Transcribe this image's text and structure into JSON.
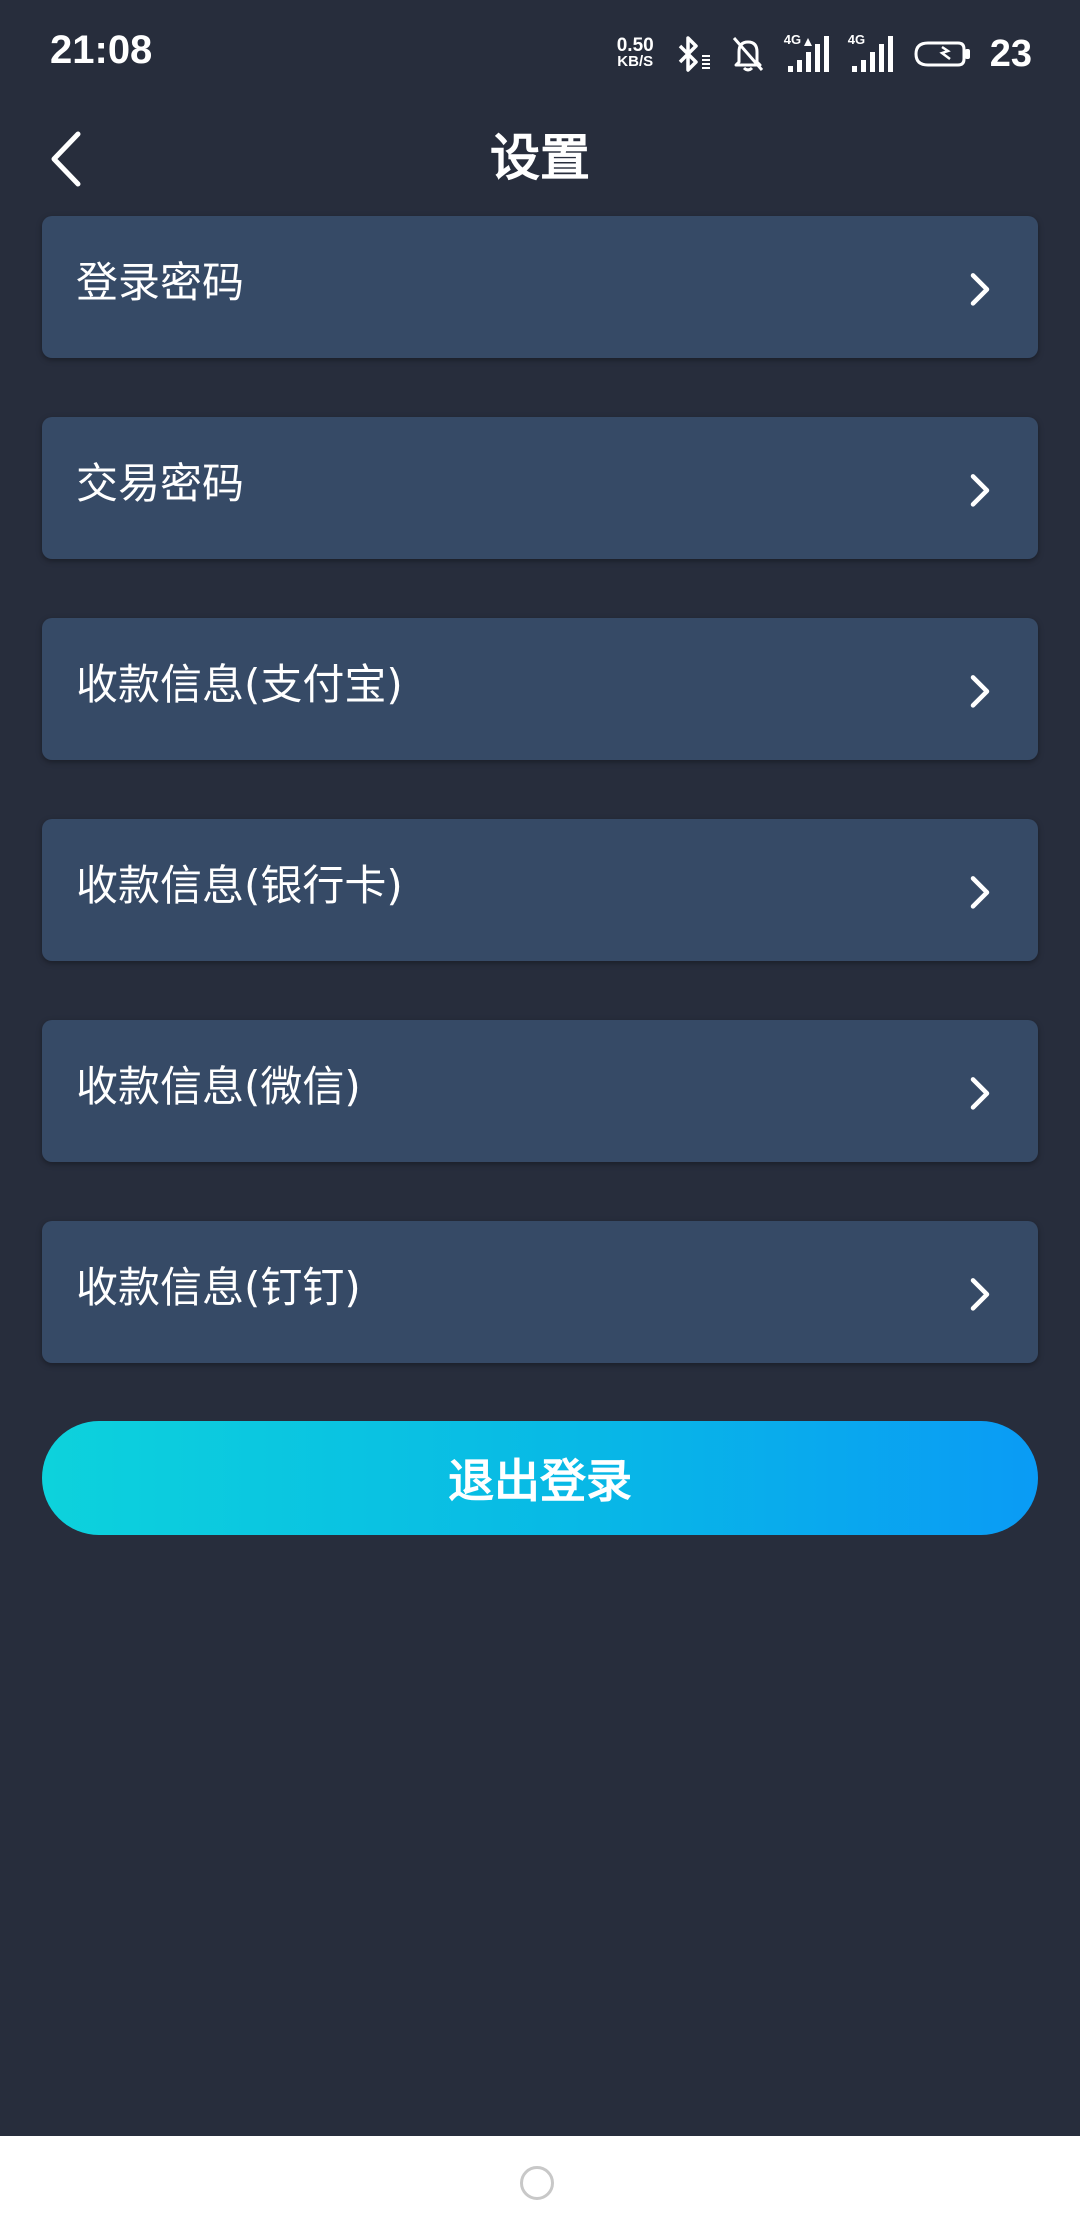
{
  "status_bar": {
    "time": "21:08",
    "net_speed_value": "0.50",
    "net_speed_unit": "KB/S",
    "sim1_label": "4G",
    "sim2_label": "4G",
    "battery_level": "23",
    "icons": [
      "bluetooth-icon",
      "mute-bell-icon",
      "signal-icon",
      "signal-icon",
      "battery-icon"
    ]
  },
  "header": {
    "title": "设置",
    "back_icon": "chevron-left-icon"
  },
  "settings": {
    "items": [
      {
        "label": "登录密码"
      },
      {
        "label": "交易密码"
      },
      {
        "label": "收款信息(支付宝)"
      },
      {
        "label": "收款信息(银行卡)"
      },
      {
        "label": "收款信息(微信)"
      },
      {
        "label": "收款信息(钉钉)"
      }
    ]
  },
  "logout": {
    "label": "退出登录"
  },
  "colors": {
    "background": "#272d3c",
    "card": "#364a66",
    "gradient_start": "#0dd2dc",
    "gradient_end": "#0a9bf5"
  }
}
